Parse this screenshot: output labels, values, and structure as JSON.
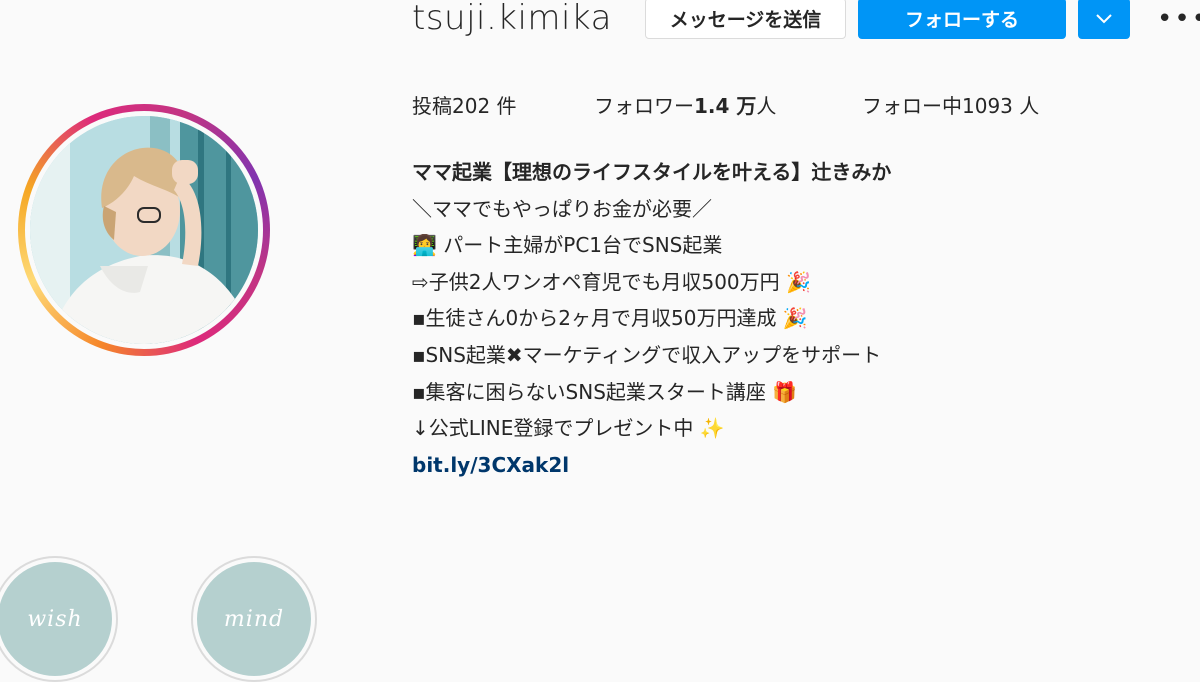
{
  "profile": {
    "username": "tsuji.kimika",
    "actions": {
      "message_label": "メッセージを送信",
      "follow_label": "フォローする",
      "dropdown_icon": "chevron-down-icon",
      "more_label": "•••"
    },
    "stats": {
      "posts_prefix": "投稿",
      "posts_value": "202",
      "posts_suffix": " 件",
      "followers_prefix": "フォロワー",
      "followers_value": "1.4 万",
      "followers_suffix": "人",
      "following_prefix": "フォロー中",
      "following_value": "1093",
      "following_suffix": " 人"
    },
    "bio": {
      "name": "ママ起業【理想のライフスタイルを叶える】辻きみか",
      "lines": [
        "＼ママでもやっぱりお金が必要／",
        "👩‍💻 パート主婦がPC1台でSNS起業",
        "⇨子供2人ワンオペ育児でも月収500万円 🎉",
        "▪生徒さん0から2ヶ月で月収50万円達成 🎉",
        "▪SNS起業✖マーケティングで収入アップをサポート",
        "▪集客に困らないSNS起業スタート講座 🎁",
        "↓公式LINE登録でプレゼント中 ✨"
      ],
      "link": "bit.ly/3CXak2l"
    }
  },
  "highlights": [
    {
      "title": "wish"
    },
    {
      "title": "mind"
    }
  ],
  "colors": {
    "follow_blue": "#0095f6",
    "link_blue": "#00376b",
    "highlight_teal": "#b5d0cf"
  }
}
